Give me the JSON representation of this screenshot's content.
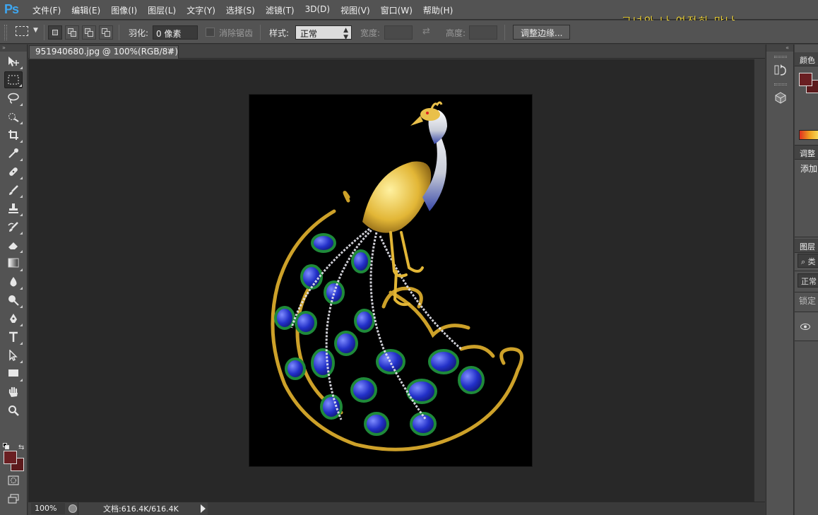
{
  "app": {
    "logo": "Ps"
  },
  "menu": [
    "文件(F)",
    "编辑(E)",
    "图像(I)",
    "图层(L)",
    "文字(Y)",
    "选择(S)",
    "滤镜(T)",
    "3D(D)",
    "视图(V)",
    "窗口(W)",
    "帮助(H)"
  ],
  "overlay_text": "그녀와 나 여전히 만나",
  "options": {
    "feather_label": "羽化:",
    "feather_value": "0 像素",
    "antialias_label": "消除锯齿",
    "style_label": "样式:",
    "style_value": "正常",
    "width_label": "宽度:",
    "height_label": "高度:",
    "refine_edge_button": "调整边缘..."
  },
  "document": {
    "tab_title": "951940680.jpg @ 100%(RGB/8#)",
    "close_glyph": "×"
  },
  "status": {
    "zoom": "100%",
    "doc_info": "文档:616.4K/616.4K"
  },
  "panels": {
    "color_title": "颜色",
    "adjustments_title": "调整",
    "adjustments_add": "添加",
    "layers_title": "图层",
    "layers_search": "⌕ 类",
    "blend_mode": "正常",
    "lock_label": "锁定"
  },
  "colors": {
    "foreground": "#6a1f22",
    "background": "#5c1a1c",
    "accent": "#3ea6f0"
  },
  "icons": {
    "toolbox_collapse": "»",
    "dock_collapse": "«"
  }
}
